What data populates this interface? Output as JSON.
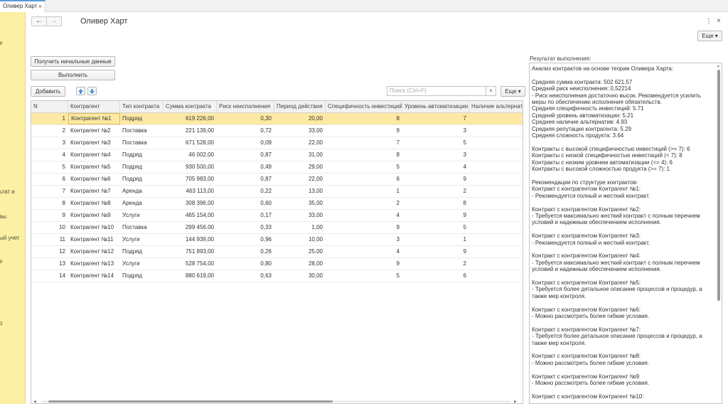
{
  "tab": {
    "title": "Оливер Харт",
    "close": "×"
  },
  "sidebar": {
    "fragments": [
      "е",
      "ьтат и",
      "вы",
      "ый учет",
      "е",
      "о"
    ]
  },
  "header": {
    "back": "←",
    "forward": "→",
    "title": "Оливер Харт",
    "menu": "⋮",
    "close": "×",
    "more": "Еще ▾"
  },
  "buttons": {
    "get_data": "Получить начальные данные",
    "run": "Выполнить",
    "add": "Добавить",
    "more": "Еще ▾"
  },
  "search": {
    "placeholder": "Поиск (Ctrl+F)",
    "clear": "×"
  },
  "table": {
    "columns": [
      "N",
      "Контрагент",
      "Тип контракта",
      "Сумма контракта",
      "Риск неисполнения",
      "Период действия",
      "Специфичность инвестиций",
      "Уровень автоматизации",
      "Наличие альтернатив"
    ],
    "rows": [
      [
        "1",
        "Контрагент №1",
        "Подряд",
        "619 226,00",
        "0,30",
        "20,00",
        "8",
        "7"
      ],
      [
        "2",
        "Контрагент №2",
        "Поставка",
        "221 139,00",
        "0,72",
        "33,00",
        "9",
        "3"
      ],
      [
        "3",
        "Контрагент №3",
        "Поставка",
        "671 528,00",
        "0,09",
        "22,00",
        "7",
        "5"
      ],
      [
        "4",
        "Контрагент №4",
        "Подряд",
        "46 002,00",
        "0,87",
        "31,00",
        "8",
        "3"
      ],
      [
        "5",
        "Контрагент №5",
        "Подряд",
        "930 500,00",
        "0,49",
        "29,00",
        "5",
        "4"
      ],
      [
        "6",
        "Контрагент №6",
        "Подряд",
        "705 983,00",
        "0,87",
        "22,00",
        "6",
        "9"
      ],
      [
        "7",
        "Контрагент №7",
        "Аренда",
        "463 113,00",
        "0,22",
        "13,00",
        "1",
        "2"
      ],
      [
        "8",
        "Контрагент №8",
        "Аренда",
        "308 396,00",
        "0,60",
        "35,00",
        "2",
        "8"
      ],
      [
        "9",
        "Контрагент №9",
        "Услуги",
        "465 154,00",
        "0,17",
        "33,00",
        "4",
        "9"
      ],
      [
        "10",
        "Контрагент №10",
        "Поставка",
        "299 456,00",
        "0,33",
        "1,00",
        "9",
        "5"
      ],
      [
        "11",
        "Контрагент №11",
        "Услуги",
        "144 939,00",
        "0,96",
        "10,00",
        "3",
        "1"
      ],
      [
        "12",
        "Контрагент №12",
        "Подряд",
        "751 893,00",
        "0,26",
        "25,00",
        "4",
        "9"
      ],
      [
        "13",
        "Контрагент №13",
        "Услуги",
        "528 754,00",
        "0,80",
        "28,00",
        "9",
        "2"
      ],
      [
        "14",
        "Контрагент №14",
        "Подряд",
        "880 619,00",
        "0,63",
        "30,00",
        "5",
        "6"
      ]
    ]
  },
  "result": {
    "label": "Результат выполнения:",
    "text": "Анализ контрактов на основе теории Оливера Харта:\n\nСредняя сумма контракта: 502 621.57\nСредний риск неисполнения: 0,52214\n- Риск неисполнения достаточно высок. Рекомендуется усилить меры по обеспечению исполнения обязательств.\nСредняя специфичность инвестиций: 5.71\nСредний уровень автоматизации: 5.21\nСреднее наличие альтернатив: 4.93\nСредняя репутация контрагента: 5.29\nСредняя сложность продукта: 3.64\n\nКонтракты с высокой специфичностью инвестиций (>= 7): 6\nКонтракты с низкой специфичностью инвестиций (< 7): 8\nКонтракты с низким уровнем автоматизации (<= 4): 6\nКонтракты с высокой сложностью продукта (>= 7): 1\n\nРекомендации по структуре контрактов:\nКонтракт с контрагентом Контрагент №1:\n- Рекомендуется полный и жесткий контракт.\n\nКонтракт с контрагентом Контрагент №2:\n- Требуется максимально жесткий контракт с полным перечнем условий и надежным обеспечением исполнения.\n\nКонтракт с контрагентом Контрагент №3:\n- Рекомендуется полный и жесткий контракт.\n\nКонтракт с контрагентом Контрагент №4:\n- Требуется максимально жесткий контракт с полным перечнем условий и надежным обеспечением исполнения.\n\nКонтракт с контрагентом Контрагент №5:\n- Требуется более детальное описание процессов и процедур, а также мер контроля.\n\nКонтракт с контрагентом Контрагент №6:\n- Можно рассмотреть более гибкие условия.\n\nКонтракт с контрагентом Контрагент №7:\n- Требуется более детальное описание процессов и процедур, а также мер контроля.\n\nКонтракт с контрагентом Контрагент №8:\n- Можно рассмотреть более гибкие условия.\n\nКонтракт с контрагентом Контрагент №9:\n- Можно рассмотреть более гибкие условия.\n\nКонтракт с контрагентом Контрагент №10:"
  },
  "icons": {
    "up": "arrow-up-icon",
    "down": "arrow-down-icon"
  },
  "colors": {
    "sidebar": "#fbf0a3",
    "selected_row": "#fbeeb8",
    "accent_blue": "#3c8ddc"
  }
}
